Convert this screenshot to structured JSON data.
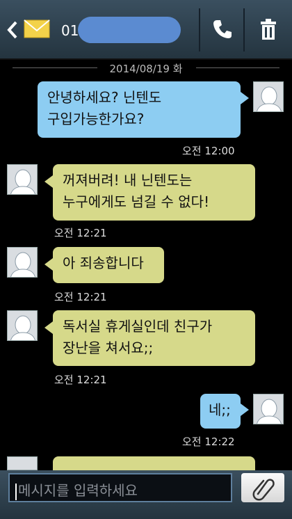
{
  "header": {
    "contact": "01",
    "icons": [
      "back-arrow-icon",
      "envelope-icon",
      "phone-icon",
      "trash-icon"
    ]
  },
  "date_separator": "2014/08/19 화",
  "messages": [
    {
      "side": "sent",
      "text_lines": [
        "안녕하세요? 닌텐도",
        "구입가능한가요?"
      ],
      "time": "오전 12:00"
    },
    {
      "side": "received",
      "text_lines": [
        "꺼져버려! 내 닌텐도는",
        "누구에게도 넘길 수 없다!"
      ],
      "time": "오전 12:21"
    },
    {
      "side": "received",
      "text_lines": [
        "아 죄송합니다"
      ],
      "time": "오전 12:21"
    },
    {
      "side": "received",
      "text_lines": [
        "독서실 휴게실인데 친구가",
        "장난을 쳐서요;;"
      ],
      "time": "오전 12:21"
    },
    {
      "side": "sent",
      "text_lines": [
        "네;;"
      ],
      "time": "오전 12:22"
    }
  ],
  "composer": {
    "placeholder": "메시지를 입력하세요",
    "attach_icon": "paperclip-icon"
  },
  "colors": {
    "sent_bubble": "#8dcdf2",
    "received_bubble": "#d6d98a",
    "background": "#000000"
  }
}
